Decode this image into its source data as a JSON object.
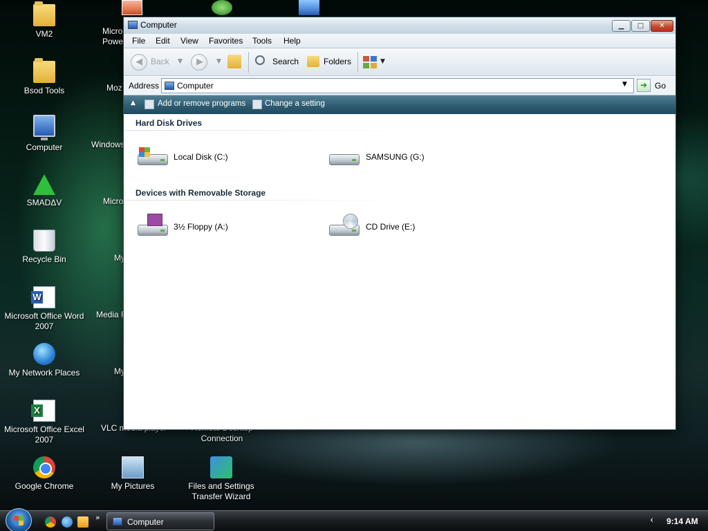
{
  "desktop": {
    "icons_left": [
      {
        "label": "VM2",
        "icon": "folder-icon"
      },
      {
        "label": "Bsod Tools",
        "icon": "folder-icon"
      },
      {
        "label": "Computer",
        "icon": "computer-icon"
      },
      {
        "label": "SMADΔV",
        "icon": "smadav-icon"
      },
      {
        "label": "Recycle Bin",
        "icon": "recycle-bin-icon"
      },
      {
        "label": "Microsoft Office Word 2007",
        "icon": "word-icon"
      },
      {
        "label": "My Network Places",
        "icon": "network-icon"
      },
      {
        "label": "Microsoft Office Excel 2007",
        "icon": "excel-icon"
      },
      {
        "label": "Google Chrome",
        "icon": "chrome-icon"
      }
    ],
    "col2_partial": [
      "Micro",
      "Powe",
      "Moz",
      "Windows",
      "Micro",
      "My",
      "Media F",
      "My",
      "VLC media player"
    ],
    "col2_bottom": {
      "label": "My Pictures",
      "icon": "pictures-icon"
    },
    "col3_partial": "Remote Desktop Connection",
    "col3_bottom": {
      "label": "Files and Settings Transfer Wizard",
      "icon": "transfer-wizard-icon"
    }
  },
  "window": {
    "title": "Computer",
    "menu": [
      "File",
      "Edit",
      "View",
      "Favorites",
      "Tools",
      "Help"
    ],
    "toolbar": {
      "back": "Back",
      "search": "Search",
      "folders": "Folders"
    },
    "address": {
      "label": "Address",
      "value": "Computer",
      "go": "Go"
    },
    "tasks": [
      "Add or remove programs",
      "Change a setting"
    ],
    "groups": [
      {
        "title": "Hard Disk Drives",
        "items": [
          "Local Disk (C:)",
          "SAMSUNG (G:)"
        ]
      },
      {
        "title": "Devices with Removable Storage",
        "items": [
          "3½ Floppy (A:)",
          "CD Drive (E:)"
        ]
      }
    ]
  },
  "taskbar": {
    "active_window": "Computer",
    "clock": "9:14 AM",
    "more": "»"
  }
}
